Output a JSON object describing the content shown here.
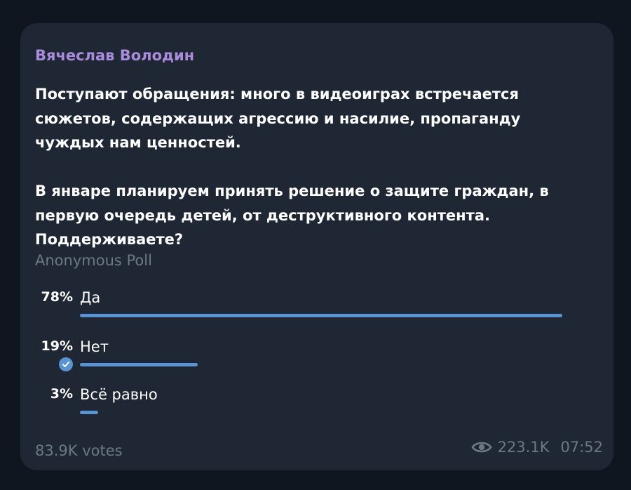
{
  "message": {
    "author": "Вячеслав Володин",
    "question": "Поступают обращения: много в видеоиграх встречается сюжетов, содержащих агрессию и насилие, пропаганду чуждых нам ценностей.\n\nВ январе планируем принять решение о защите граждан, в первую очередь детей, от деструктивного контента. Поддерживаете?",
    "poll_type": "Anonymous Poll",
    "options": [
      {
        "percent": "78%",
        "label": "Да",
        "fraction": 0.78,
        "selected": false
      },
      {
        "percent": "19%",
        "label": "Нет",
        "fraction": 0.19,
        "selected": true
      },
      {
        "percent": "3%",
        "label": "Всё равно",
        "fraction": 0.03,
        "selected": false
      }
    ],
    "votes": "83.9K votes",
    "views": "223.1K",
    "time": "07:52"
  },
  "colors": {
    "background": "#10161f",
    "bubble": "#1e2733",
    "author": "#a98ddc",
    "accent": "#5a93d2",
    "muted": "#6d7886",
    "text": "#ffffff"
  },
  "icons": {
    "selected": "check-circle-icon",
    "views": "eye-icon"
  }
}
